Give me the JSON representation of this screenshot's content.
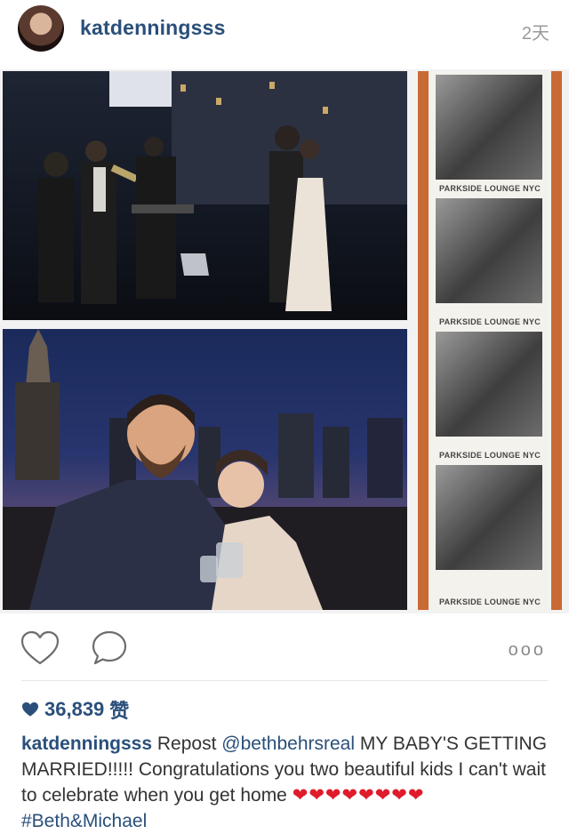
{
  "post": {
    "username": "katdenningsss",
    "time_ago": "2天"
  },
  "photo_strip": {
    "labels": [
      "PARKSIDE LOUNGE NYC",
      "PARKSIDE LOUNGE NYC",
      "PARKSIDE LOUNGE NYC",
      "PARKSIDE LOUNGE NYC"
    ]
  },
  "actions": {
    "like_icon": "heart-outline-icon",
    "comment_icon": "comment-bubble-icon",
    "more_label": "ooo"
  },
  "likes": {
    "count": "36,839",
    "unit": "赞"
  },
  "caption": {
    "username": "katdenningsss",
    "word_repost": "Repost",
    "mention": "@bethbehrsreal",
    "text": "MY BABY'S GETTING MARRIED!!!!! Congratulations you two beautiful kids I can't wait to celebrate when you get home",
    "hearts": "❤❤❤❤❤❤❤❤",
    "hashtag": "#Beth&Michael"
  },
  "colors": {
    "accent": "#2a4f7a",
    "heart": "#e01b2c"
  }
}
